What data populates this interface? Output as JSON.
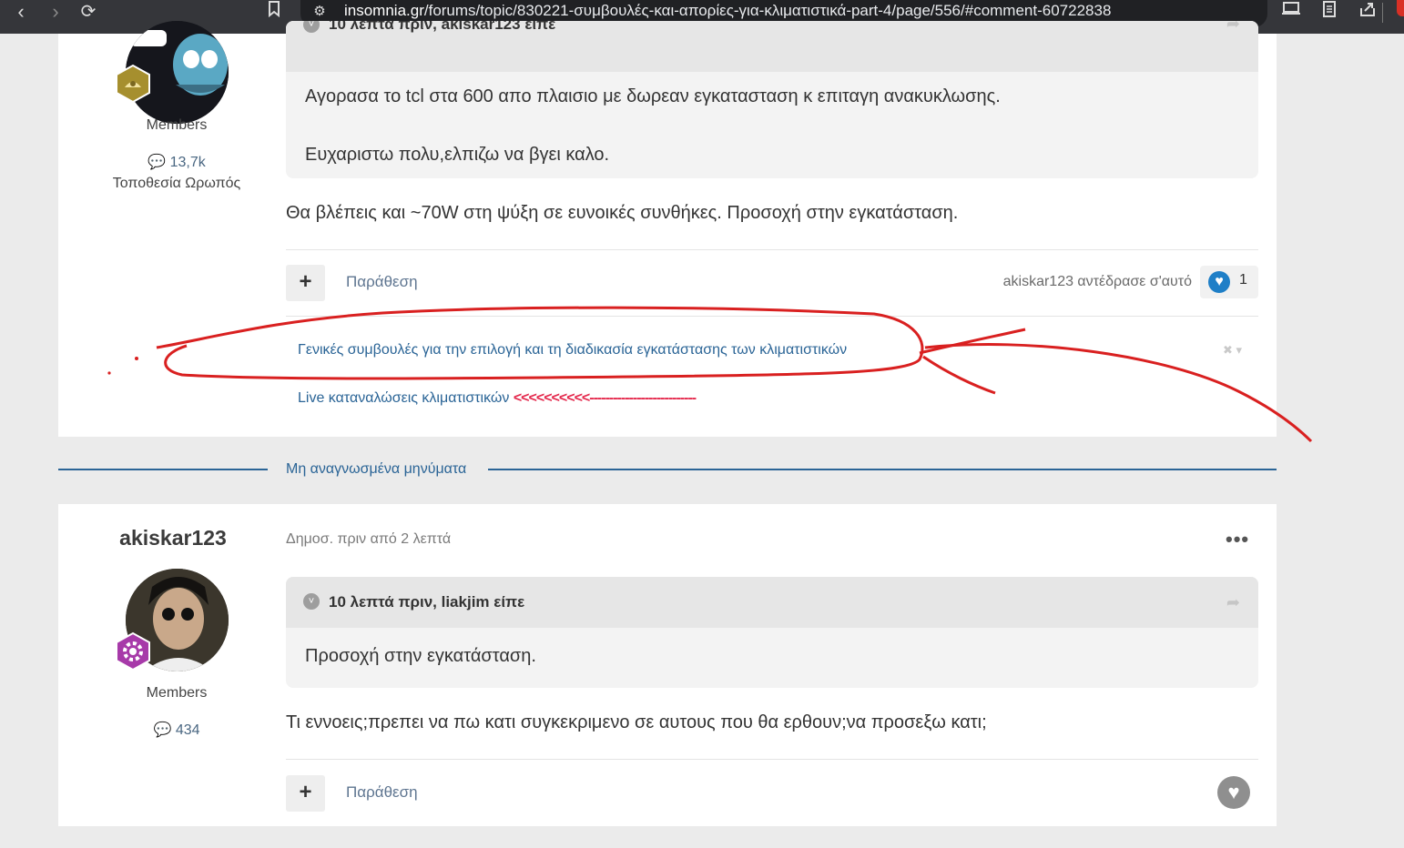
{
  "browser": {
    "url_host": "insomnia.gr",
    "url_path": "/forums/topic/830221-συμβουλές-και-απορίες-για-κλιματιστικά-part-4/page/556/#comment-60722838",
    "icons": [
      "back-icon",
      "forward-icon",
      "reload-icon",
      "bookmark-icon",
      "site-settings-icon",
      "install-icon",
      "reader-icon",
      "share-icon"
    ]
  },
  "post1": {
    "member_group": "Members",
    "post_count": "13,7k",
    "location": "Τοποθεσία Ωρωπός",
    "quote_header": "10 λεπτά πριν, akiskar123 είπε",
    "quote_lines": [
      "Αγορασα το tcl στα 600 απο πλαισιο με δωρεαν εγκατασταση κ επιταγη ανακυκλωσης.",
      "Ευχαριστω πολυ,ελπιζω να βγει καλο."
    ],
    "body": "Θα βλέπεις και ~70W στη ψύξη σε ευνοικές συνθήκες. Προσοχή στην εγκατάσταση.",
    "quote_button": "Παράθεση",
    "reaction_text": "akiskar123 αντέδρασε σ'αυτό",
    "reaction_count": "1",
    "related_links": [
      "Γενικές συμβουλές για την επιλογή και τη διαδικασία εγκατάστασης των κλιματιστικών",
      "Live καταναλώσεις κλιματιστικών"
    ],
    "related_arrows": "<<<<<<<<<<---------------------------"
  },
  "unread_label": "Μη αναγνωσμένα μηνύματα",
  "post2": {
    "author": "akiskar123",
    "date": "Δημοσ. πριν από 2 λεπτά",
    "member_group": "Members",
    "post_count": "434",
    "quote_header": "10 λεπτά πριν, liakjim είπε",
    "quote_lines": [
      "Προσοχή στην εγκατάσταση."
    ],
    "body": "Τι εννοεις;πρεπει να πω κατι συγκεκριμενο σε αυτους που θα ερθουν;να προσεξω κατι;",
    "quote_button": "Παράθεση",
    "more": "•••"
  },
  "colors": {
    "accent": "#2a6496",
    "annotation_red": "#d92020",
    "reaction_blue": "#1f7fc7"
  }
}
